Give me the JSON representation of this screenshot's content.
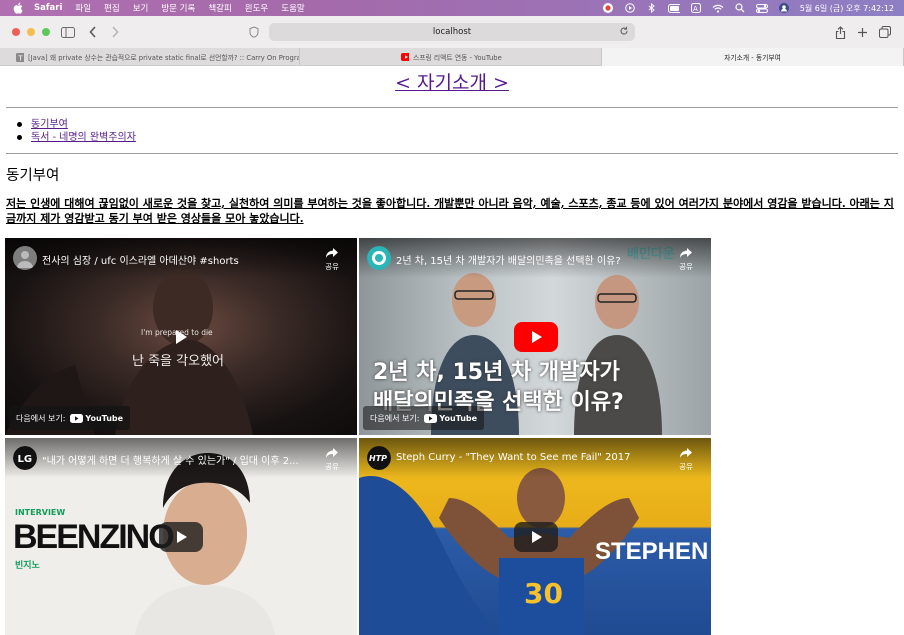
{
  "menubar": {
    "app": "Safari",
    "items": [
      "파일",
      "편집",
      "보기",
      "방문 기록",
      "책갈피",
      "윈도우",
      "도움말"
    ],
    "clock": "5월 6일 (금) 오후 7:42:12"
  },
  "browser": {
    "url": "localhost",
    "tabs": [
      {
        "label": "[Java] 왜 private 상수는 관습적으로 private static final로 선언할까? :: Carry On Progra...",
        "favicon": "t-favicon"
      },
      {
        "label": "스프링 리액트 연동 - YouTube",
        "favicon": "youtube-favicon"
      },
      {
        "label": "자기소개 - 동기부여",
        "favicon": ""
      }
    ]
  },
  "page": {
    "title": "< 자기소개 >",
    "toc": [
      "동기부여",
      "독서 - 네명의 완벽주의자"
    ],
    "section_title": "동기부여",
    "intro": "저는 인생에 대해여 끊임없이 새로운 것을 찾고, 실천하여 의미를 부여하는 것을 좋아합니다. 개발뿐만 아니라 음악, 예술, 스포츠, 종교 등에 있어 여러가지 분야에서 영감을 받습니다. 아래는 지금까지 제가 영감받고 동기 부여 받은 영상들을 모아 놓았습니다."
  },
  "videos": [
    {
      "title": "전사의 심장 / ufc 이스라엘 아데산야 #shorts",
      "share": "공유",
      "watch_on": "다음에서 보기:",
      "yt": "YouTube",
      "overlay_lines": [
        "I'm prepared to die",
        "난 죽을 각오했어"
      ]
    },
    {
      "title": "2년 차, 15년 차 개발자가 배달의민족을 선택한 이유?",
      "share": "공유",
      "watch_on": "다음에서 보기:",
      "yt": "YouTube",
      "overlay_lines": [
        "2년 차, 15년 차 개발자가",
        "배달의민족을 선택한 이유?"
      ],
      "brand": "배민다운"
    },
    {
      "title": "\"내가 어떻게 하면 더 행복하게 살 수 있는가\" / 입대 이후 2...",
      "share": "공유",
      "overlay_lines": [
        "INTERVIEW",
        "BEENZINO",
        "빈지노"
      ]
    },
    {
      "title": "Steph Curry - \"They Want to See me Fail\" 2017",
      "share": "공유",
      "overlay_lines": [
        "STEPHEN"
      ]
    }
  ],
  "colors": {
    "link": "#551a8b",
    "youtube_red": "#ff0000",
    "menubar": "#a46aaa"
  }
}
